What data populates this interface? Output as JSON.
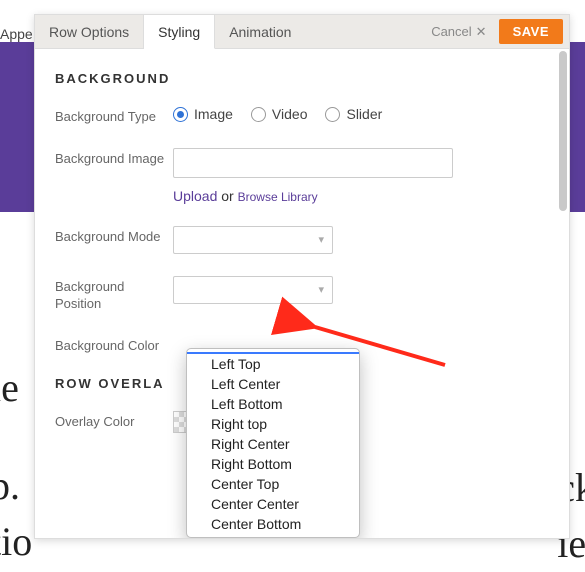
{
  "app_label": "Appe",
  "tabs": {
    "row_options": "Row Options",
    "styling": "Styling",
    "animation": "Animation"
  },
  "actions": {
    "cancel": "Cancel",
    "save": "SAVE"
  },
  "sections": {
    "background": "BACKGROUND",
    "row_overlay": "ROW OVERLA"
  },
  "fields": {
    "bg_type_label": "Background Type",
    "bg_type_options": {
      "image": "Image",
      "video": "Video",
      "slider": "Slider"
    },
    "bg_image_label": "Background Image",
    "bg_image_value": "",
    "upload": "Upload",
    "or": " or ",
    "browse": "Browse Library",
    "bg_mode_label": "Background Mode",
    "bg_mode_value": "",
    "bg_position_label": "Background Position",
    "bg_color_label": "Background Color",
    "overlay_color_label": "Overlay Color"
  },
  "dropdown": {
    "items": [
      "",
      "Left Top",
      "Left Center",
      "Left Bottom",
      "Right top",
      "Right Center",
      "Right Bottom",
      "Center Top",
      "Center Center",
      "Center Bottom"
    ],
    "selected_index": 0
  },
  "bg_text": {
    "left_1": "ie",
    "left_2": "p.",
    "left_3": "tio",
    "right_1": "ck",
    "right_2": "ie"
  }
}
